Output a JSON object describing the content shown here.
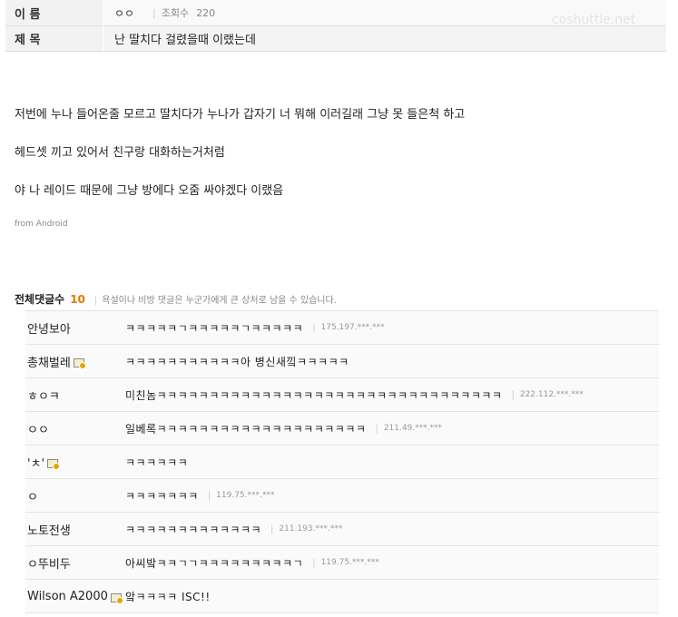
{
  "post": {
    "name_label": "이 름",
    "author": "ㅇㅇ",
    "views_label": "조회수",
    "views": "220",
    "title_label": "제 목",
    "title": "난 딸치다 걸렸을때 이랬는데",
    "body": [
      "저번에 누나 들어온줄 모르고 딸치다가 누나가 갑자기 너 뭐해 이러길래 그냥 못 들은척 하고",
      "헤드셋 끼고 있어서 친구랑 대화하는거처럼",
      "야 나 레이드 때문에 그냥 방에다 오줌 싸야겠다 이랬음"
    ],
    "from": "from Android"
  },
  "watermark": "coshuttle.net",
  "comments_section": {
    "title": "전체댓글수",
    "count": "10",
    "notice": "욕설이나 비방 댓글은 누군가에게 큰 상처로 남을 수 있습니다."
  },
  "comments": [
    {
      "name": "안녕보아",
      "text": "ㅋㅋㅋㅋㅋㄱㅋㅋㅋㅋㅋㄱㅋㅋㅋㅋㅋ",
      "ip": "175.197.***.***",
      "member": false
    },
    {
      "name": "총채벌레",
      "text": "ㅋㅋㅋㅋㅋㅋㅋㅋㅋㅋㅋ아 병신새낔ㅋㅋㅋㅋㅋ",
      "ip": "",
      "member": true
    },
    {
      "name": "ㅎㅇㅋ",
      "text": "미친놈ㅋㅋㅋㅋㅋㅋㅋㅋㅋㅋㅋㅋㅋㅋㅋㅋㅋㅋㅋㅋㅋㅋㅋㅋㅋㅋㅋㅋㅋㅋㅋㅋㅋ",
      "ip": "222.112.***.***",
      "member": false
    },
    {
      "name": "ㅇㅇ",
      "text": "일베록ㅋㅋㅋㅋㅋㅋㅋㅋㅋㅋㅋㅋㅋㅋㅋㅋㅋㅋㅋㅋ",
      "ip": "211.49.***.***",
      "member": false
    },
    {
      "name": "'ㅊ'",
      "text": "ㅋㅋㅋㅋㅋㅋ",
      "ip": "",
      "member": true
    },
    {
      "name": "ㅇ",
      "text": "ㅋㅋㅋㅋㅋㅋㅋ",
      "ip": "119.75.***.***",
      "member": false
    },
    {
      "name": "노토전생",
      "text": "ㅋㅋㅋㅋㅋㅋㅋㅋㅋㅋㅋㅋㅋ",
      "ip": "211.193.***.***",
      "member": false
    },
    {
      "name": "ㅇ뚜비두",
      "text": "아씨밬ㅋㅋㄱㄱㅋㅋㅋㅋㅋㅋㅋㅋㅋㄱ",
      "ip": "119.75.***.***",
      "member": false
    },
    {
      "name": "Wilson A2000",
      "text": "앜ㅋㅋㅋㅋ ISC!!",
      "ip": "",
      "member": true
    }
  ]
}
